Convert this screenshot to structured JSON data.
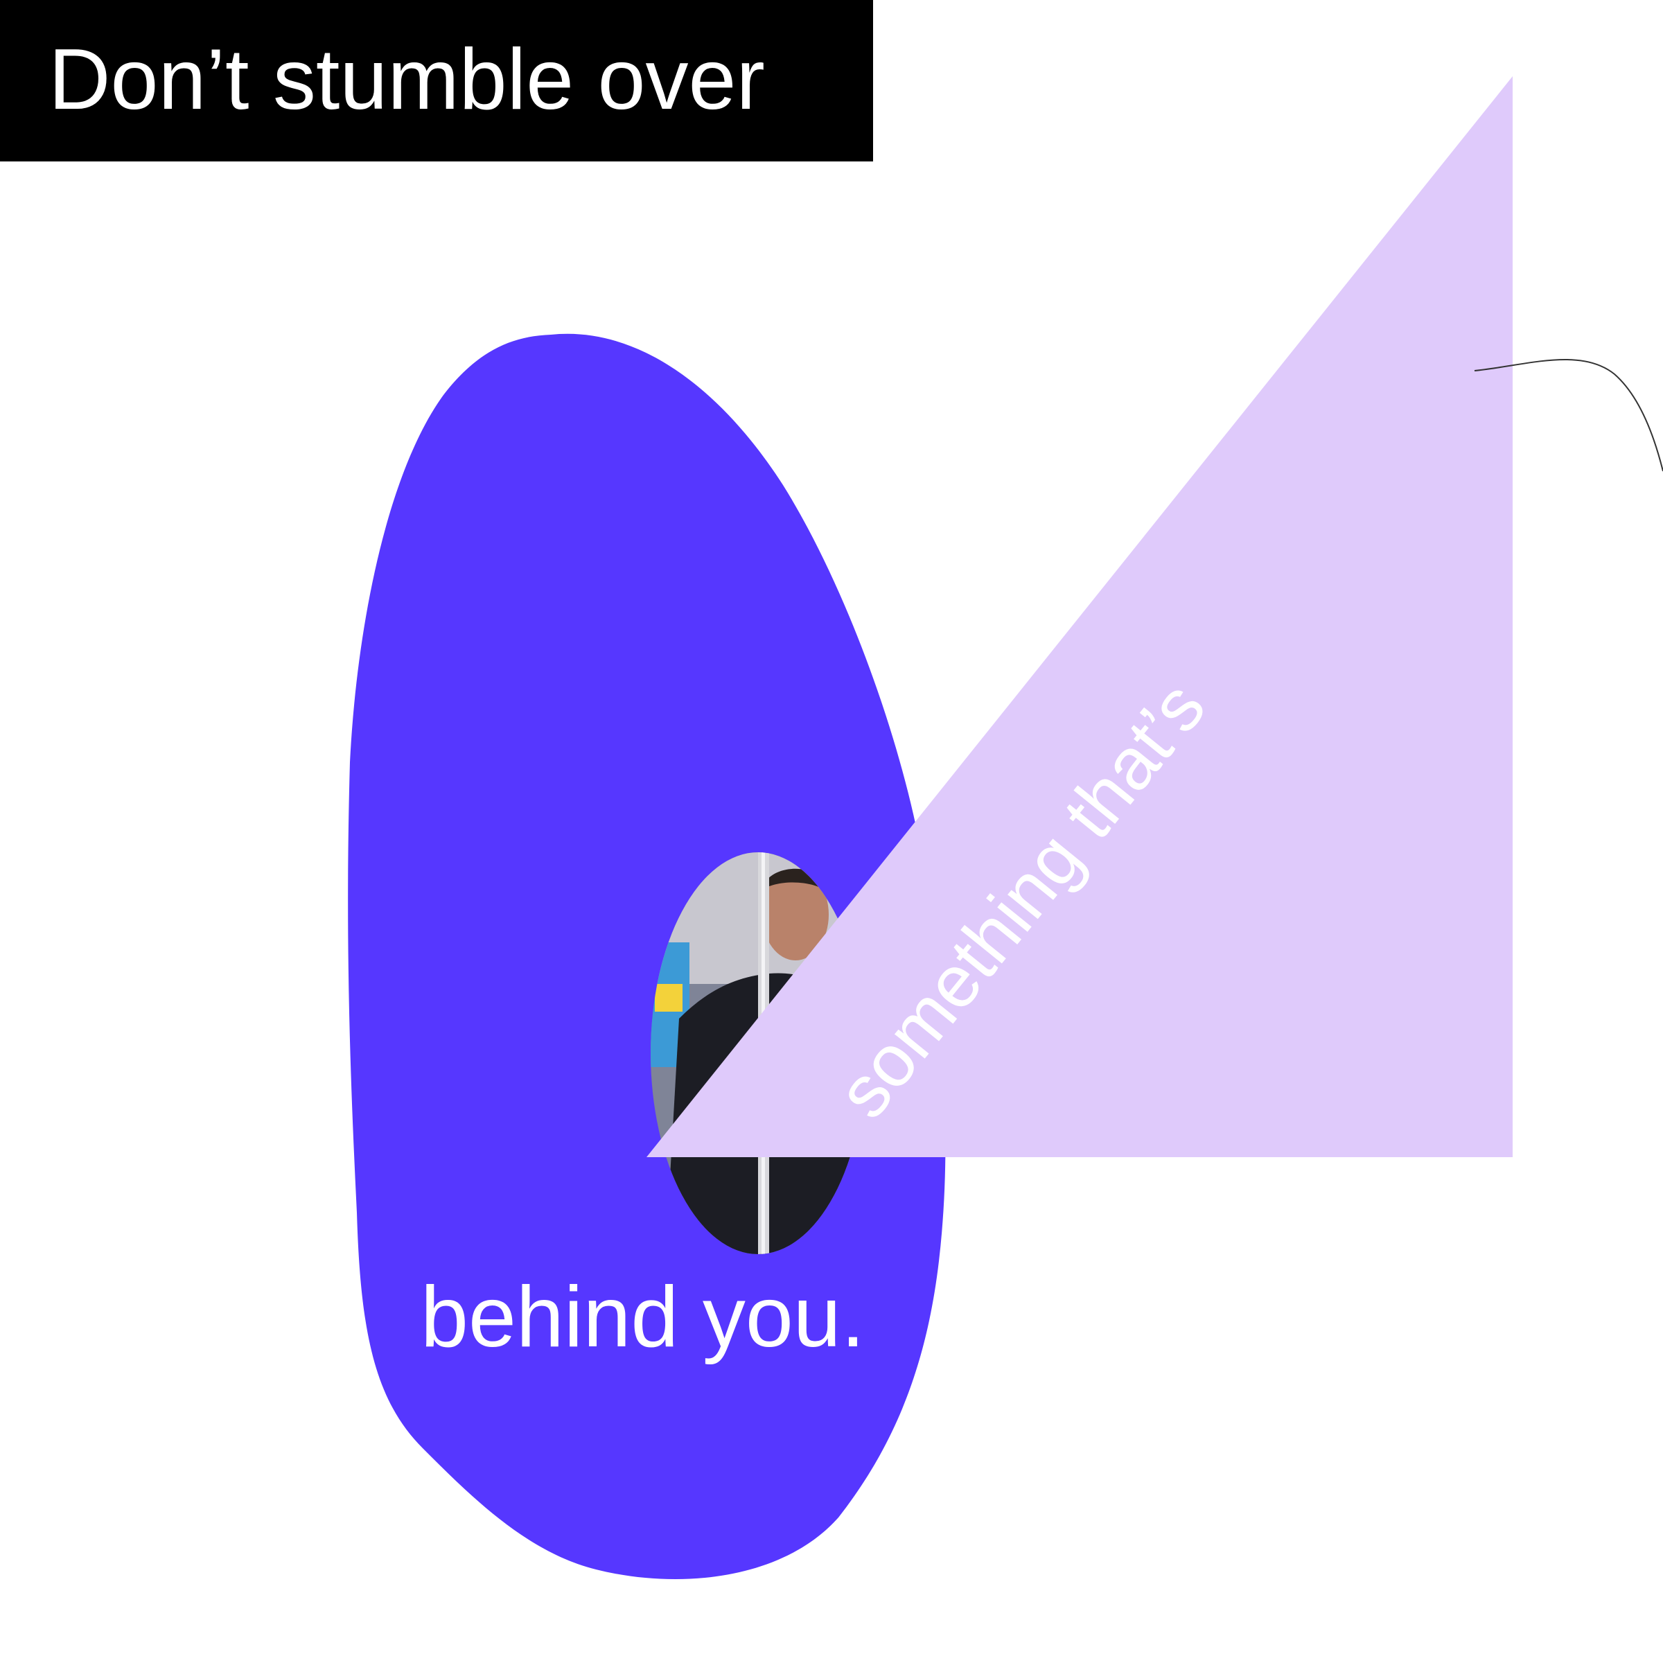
{
  "poster": {
    "headline": "Don’t stumble over",
    "diagonal_text": "something that’s",
    "closing_text": "behind you."
  },
  "colors": {
    "headline_box": "#000000",
    "headline_text": "#ffffff",
    "blob": "#5637ff",
    "triangle": "#dfcafb",
    "body_text": "#ffffff",
    "line": "#333333"
  },
  "photo": {
    "description_icon": "man-on-subway-photo"
  }
}
